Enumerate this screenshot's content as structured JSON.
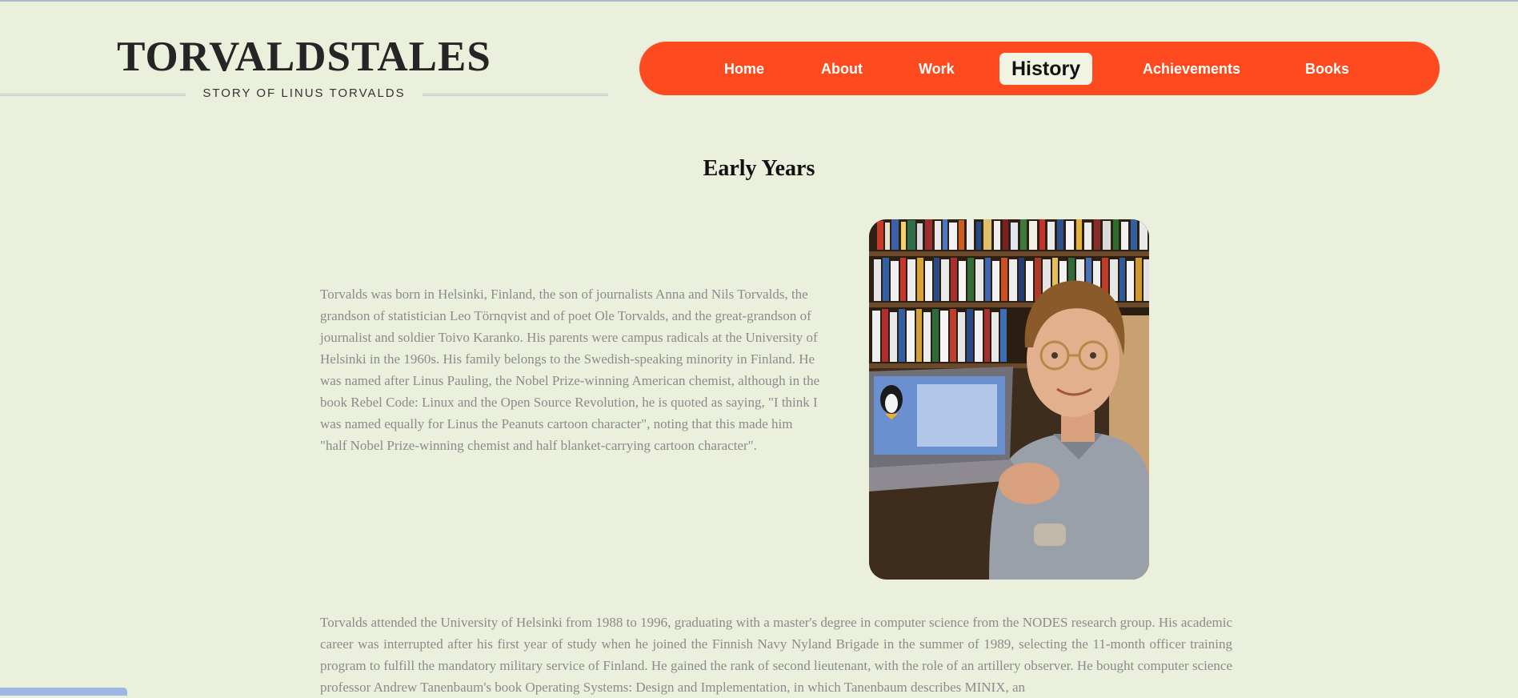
{
  "brand": {
    "title": "TORVALDSTALES",
    "tagline": "STORY OF LINUS TORVALDS"
  },
  "nav": {
    "items": [
      {
        "label": "Home",
        "active": false
      },
      {
        "label": "About",
        "active": false
      },
      {
        "label": "Work",
        "active": false
      },
      {
        "label": "History",
        "active": true
      },
      {
        "label": "Achievements",
        "active": false
      },
      {
        "label": "Books",
        "active": false
      }
    ]
  },
  "section": {
    "title": "Early Years",
    "paragraph1": "Torvalds was born in Helsinki, Finland, the son of journalists Anna and Nils Torvalds, the grandson of statistician Leo Törnqvist and of poet Ole Torvalds, and the great-grandson of journalist and soldier Toivo Karanko. His parents were campus radicals at the University of Helsinki in the 1960s. His family belongs to the Swedish-speaking minority in Finland. He was named after Linus Pauling, the Nobel Prize-winning American chemist, although in the book Rebel Code: Linux and the Open Source Revolution, he is quoted as saying, \"I think I was named equally for Linus the Peanuts cartoon character\", noting that this made him \"half Nobel Prize-winning chemist and half blanket-carrying cartoon character\".",
    "paragraph2": "Torvalds attended the University of Helsinki from 1988 to 1996, graduating with a master's degree in computer science from the NODES research group. His academic career was interrupted after his first year of study when he joined the Finnish Navy Nyland Brigade in the summer of 1989, selecting the 11-month officer training program to fulfill the mandatory military service of Finland. He gained the rank of second lieutenant, with the role of an artillery observer. He bought computer science professor Andrew Tanenbaum's book Operating Systems: Design and Implementation, in which Tanenbaum describes MINIX, an"
  },
  "colors": {
    "background": "#ebf0dc",
    "nav_bg": "#fd4a1e",
    "nav_active_bg": "#f1f4e3",
    "body_text": "#8b8b8b"
  },
  "photo": {
    "icon": "portrait-photo-icon"
  }
}
